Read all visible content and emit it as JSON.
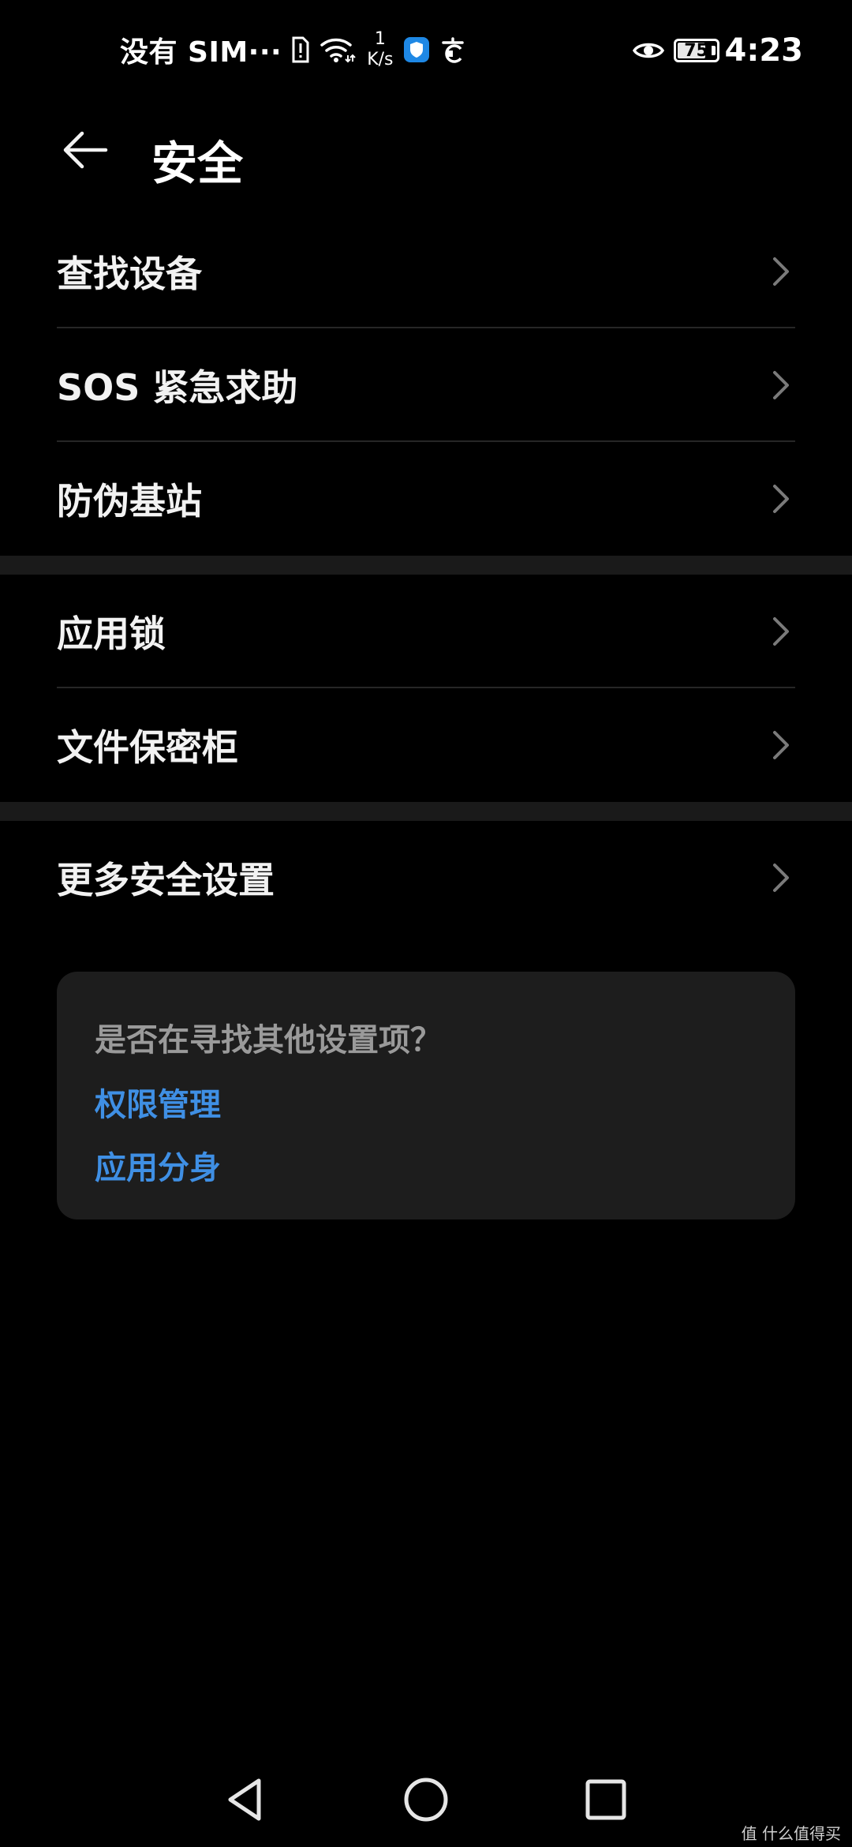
{
  "status_bar": {
    "carrier": "没有 SIM···",
    "net_speed_value": "1",
    "net_speed_unit": "K/s",
    "battery_level": 75,
    "battery_label": "75",
    "time": "4:23",
    "icons": [
      "sim-alert-icon",
      "wifi-icon",
      "shield-app-icon",
      "notification-app-icon",
      "eye-comfort-icon",
      "battery-icon"
    ]
  },
  "header": {
    "title": "安全",
    "back_icon": "arrow-left-icon"
  },
  "groups": [
    {
      "items": [
        {
          "label": "查找设备"
        },
        {
          "label": "SOS 紧急求助"
        },
        {
          "label": "防伪基站"
        }
      ]
    },
    {
      "items": [
        {
          "label": "应用锁"
        },
        {
          "label": "文件保密柜"
        }
      ]
    },
    {
      "items": [
        {
          "label": "更多安全设置"
        }
      ]
    }
  ],
  "suggestion_card": {
    "question": "是否在寻找其他设置项？",
    "links": [
      {
        "label": "权限管理"
      },
      {
        "label": "应用分身"
      }
    ]
  },
  "nav_bar": {
    "buttons": [
      "back-triangle-icon",
      "home-circle-icon",
      "recents-square-icon"
    ]
  },
  "watermark": "值 什么值得买",
  "colors": {
    "background": "#000000",
    "text_primary": "#f2f2f2",
    "text_secondary": "#9a9a9a",
    "link": "#3f8fe4",
    "card_bg": "#1d1d1d",
    "separator_band": "#1a1a1a",
    "app_shield": "#1e88e5"
  }
}
